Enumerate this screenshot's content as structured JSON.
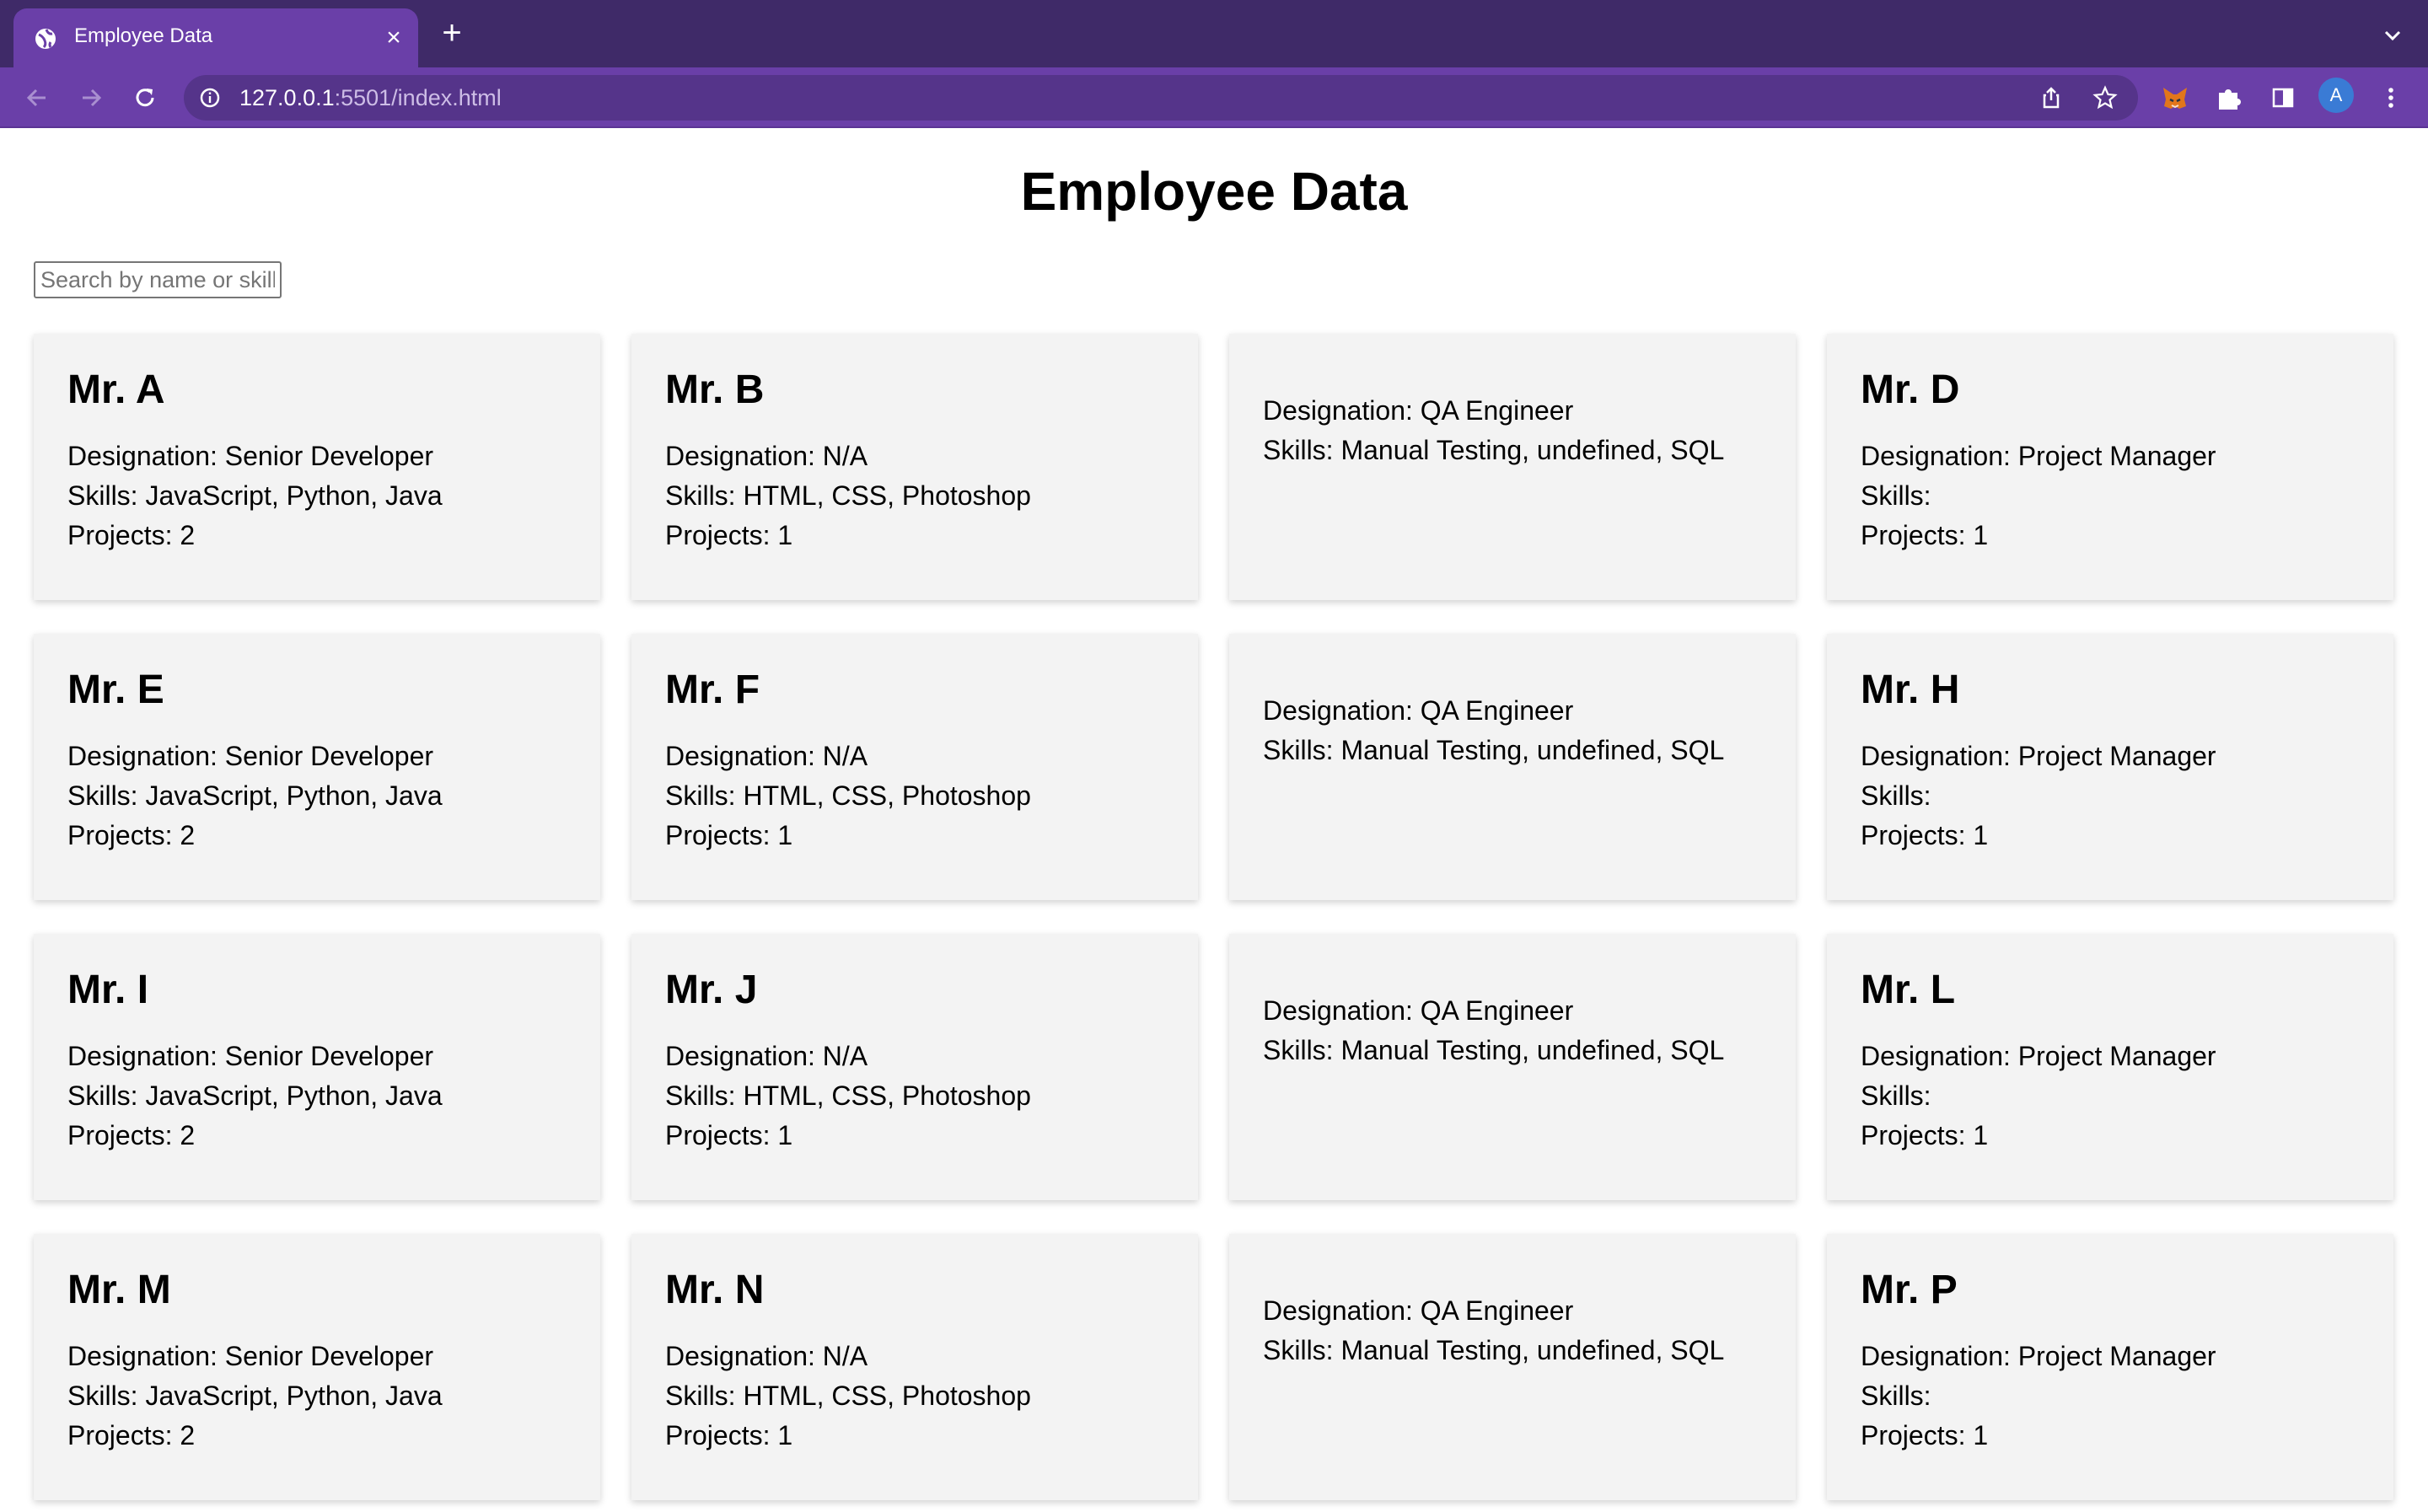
{
  "browser": {
    "tab_title": "Employee Data",
    "close_glyph": "×",
    "new_tab_glyph": "+",
    "url_host": "127.0.0.1",
    "url_path": ":5501/index.html",
    "profile_initial": "A",
    "theme_color": "#6a3fa8",
    "icons": [
      "globe-icon",
      "back-icon",
      "forward-icon",
      "reload-icon",
      "info-icon",
      "share-icon",
      "star-icon",
      "metamask-icon",
      "extensions-icon",
      "side-panel-icon",
      "menu-icon",
      "chevron-down-icon"
    ]
  },
  "page": {
    "title": "Employee Data",
    "search_placeholder": "Search by name or skill"
  },
  "employees": [
    {
      "name": "Mr. A",
      "designation": "Designation: Senior Developer",
      "skills": "Skills: JavaScript, Python, Java",
      "projects": "Projects: 2"
    },
    {
      "name": "Mr. B",
      "designation": "Designation: N/A",
      "skills": "Skills: HTML, CSS, Photoshop",
      "projects": "Projects: 1"
    },
    {
      "name": "",
      "designation": "Designation: QA Engineer",
      "skills": "Skills: Manual Testing, undefined, SQL",
      "projects": ""
    },
    {
      "name": "Mr. D",
      "designation": "Designation: Project Manager",
      "skills": "Skills:",
      "projects": "Projects: 1"
    },
    {
      "name": "Mr. E",
      "designation": "Designation: Senior Developer",
      "skills": "Skills: JavaScript, Python, Java",
      "projects": "Projects: 2"
    },
    {
      "name": "Mr. F",
      "designation": "Designation: N/A",
      "skills": "Skills: HTML, CSS, Photoshop",
      "projects": "Projects: 1"
    },
    {
      "name": "",
      "designation": "Designation: QA Engineer",
      "skills": "Skills: Manual Testing, undefined, SQL",
      "projects": ""
    },
    {
      "name": "Mr. H",
      "designation": "Designation: Project Manager",
      "skills": "Skills:",
      "projects": "Projects: 1"
    },
    {
      "name": "Mr. I",
      "designation": "Designation: Senior Developer",
      "skills": "Skills: JavaScript, Python, Java",
      "projects": "Projects: 2"
    },
    {
      "name": "Mr. J",
      "designation": "Designation: N/A",
      "skills": "Skills: HTML, CSS, Photoshop",
      "projects": "Projects: 1"
    },
    {
      "name": "",
      "designation": "Designation: QA Engineer",
      "skills": "Skills: Manual Testing, undefined, SQL",
      "projects": ""
    },
    {
      "name": "Mr. L",
      "designation": "Designation: Project Manager",
      "skills": "Skills:",
      "projects": "Projects: 1"
    },
    {
      "name": "Mr. M",
      "designation": "Designation: Senior Developer",
      "skills": "Skills: JavaScript, Python, Java",
      "projects": "Projects: 2"
    },
    {
      "name": "Mr. N",
      "designation": "Designation: N/A",
      "skills": "Skills: HTML, CSS, Photoshop",
      "projects": "Projects: 1"
    },
    {
      "name": "",
      "designation": "Designation: QA Engineer",
      "skills": "Skills: Manual Testing, undefined, SQL",
      "projects": ""
    },
    {
      "name": "Mr. P",
      "designation": "Designation: Project Manager",
      "skills": "Skills:",
      "projects": "Projects: 1"
    }
  ]
}
